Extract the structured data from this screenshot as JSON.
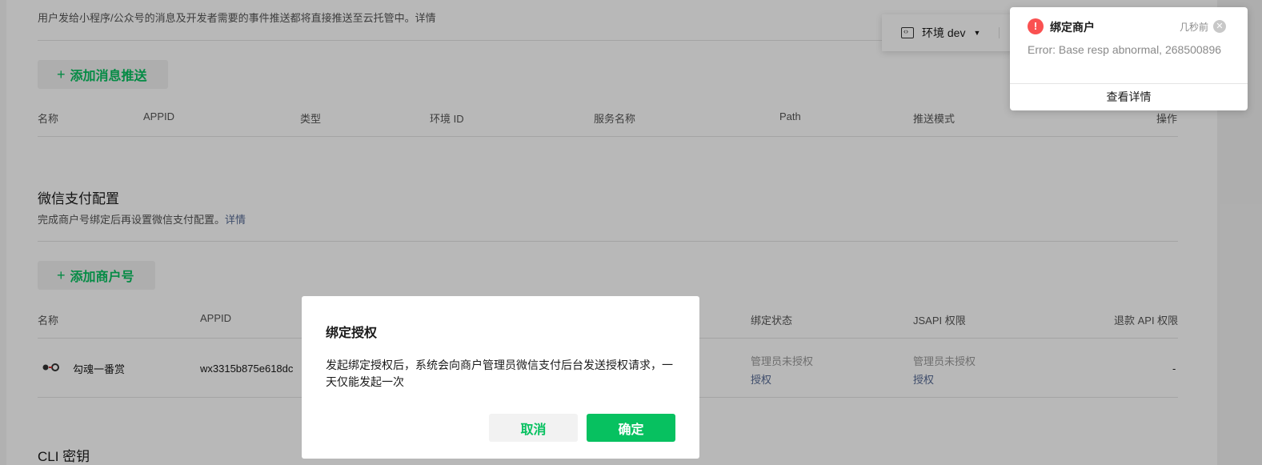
{
  "page": {
    "intro_text": "用户发给小程序/公众号的消息及开发者需要的事件推送都将直接推送至云托管中。详情",
    "add_push_button": "添加消息推送",
    "push_table": {
      "headers": [
        "名称",
        "APPID",
        "类型",
        "环境 ID",
        "服务名称",
        "Path",
        "推送模式",
        "操作"
      ]
    },
    "pay_section": {
      "title": "微信支付配置",
      "desc": "完成商户号绑定后再设置微信支付配置。",
      "desc_link": "详情",
      "add_button": "添加商户号",
      "headers": [
        "名称",
        "APPID",
        "绑定状态",
        "JSAPI 权限",
        "退款 API 权限"
      ],
      "row": {
        "name": "勾魂一番赏",
        "appid": "wx3315b875e618dc",
        "bind_status": "管理员未授权",
        "bind_action": "授权",
        "jsapi_status": "管理员未授权",
        "jsapi_action": "授权",
        "refund": "-"
      }
    },
    "cli_section": {
      "title": "CLI 密钥"
    }
  },
  "env_selector": {
    "label": "环境 dev"
  },
  "dialog": {
    "title": "绑定授权",
    "body": "发起绑定授权后，系统会向商户管理员微信支付后台发送授权请求，一天仅能发起一次",
    "cancel_label": "取消",
    "confirm_label": "确定"
  },
  "toast": {
    "title": "绑定商户",
    "time": "几秒前",
    "message": "Error: Base resp abnormal, 268500896",
    "action": "查看详情"
  },
  "colors": {
    "accent": "#07c160",
    "link": "#576b95",
    "error": "#fa5151"
  }
}
